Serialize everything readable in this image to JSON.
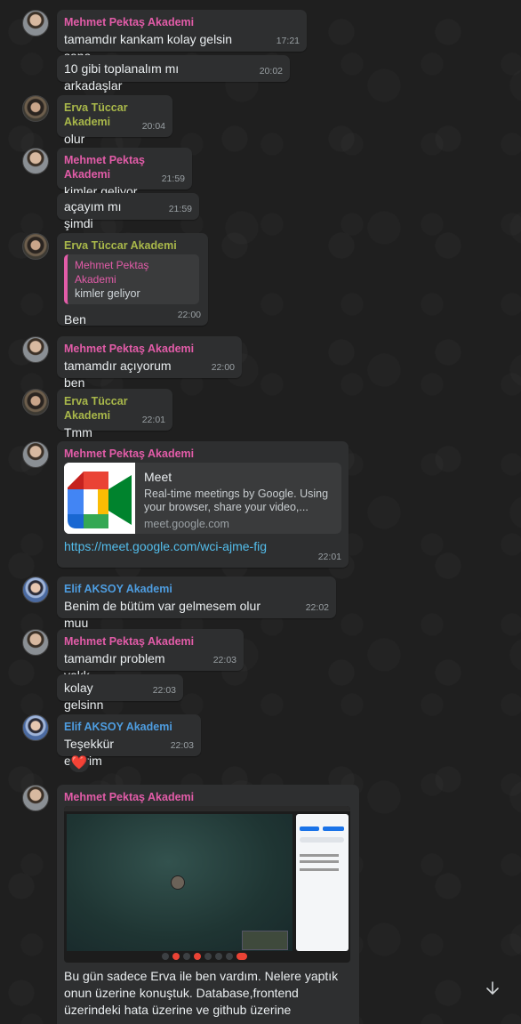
{
  "colors": {
    "background": "#1f1f1f",
    "bubble": "#2e2f30",
    "mehmet": "#e25ca8",
    "erva": "#a9b84a",
    "elif": "#4e9de0",
    "link": "#53bdeb"
  },
  "messages": {
    "m1": {
      "sender": "Mehmet Pektaş Akademi",
      "text": "tamamdır kankam kolay gelsin sana",
      "time": "17:21"
    },
    "m2": {
      "text": "10 gibi toplanalım mı arkadaşlar",
      "time": "20:02"
    },
    "m3": {
      "sender": "Erva Tüccar Akademi",
      "text": "olur",
      "time": "20:04"
    },
    "m4": {
      "sender": "Mehmet Pektaş Akademi",
      "text": "kimler geliyor",
      "time": "21:59"
    },
    "m5": {
      "text": "açayım mı şimdi",
      "time": "21:59"
    },
    "m6": {
      "sender": "Erva Tüccar Akademi",
      "quote_sender": "Mehmet Pektaş Akademi",
      "quote_text": "kimler geliyor",
      "text": "Ben",
      "time": "22:00"
    },
    "m7": {
      "sender": "Mehmet Pektaş Akademi",
      "text": "tamamdır açıyorum ben",
      "time": "22:00"
    },
    "m8": {
      "sender": "Erva Tüccar Akademi",
      "text": "Tmm",
      "time": "22:01"
    },
    "m9": {
      "sender": "Mehmet Pektaş Akademi",
      "link_title": "Meet",
      "link_desc": "Real-time meetings by Google. Using your browser, share your video,...",
      "link_domain": "meet.google.com",
      "url": "https://meet.google.com/wci-ajme-fig",
      "time": "22:01"
    },
    "m10": {
      "sender": "Elif AKSOY Akademi",
      "text": "Benim de bütüm var gelmesem olur muu",
      "time": "22:02"
    },
    "m11": {
      "sender": "Mehmet Pektaş Akademi",
      "text": "tamamdır problem yokk",
      "time": "22:03"
    },
    "m12": {
      "text": "kolay gelsinn",
      "time": "22:03"
    },
    "m13": {
      "sender": "Elif AKSOY Akademi",
      "text": "Teşekkür ederim",
      "time": "22:03",
      "reaction": "❤️"
    },
    "m14": {
      "sender": "Mehmet Pektaş Akademi",
      "text": "Bu gün sadece Erva ile ben vardım. Nelere yaptık onun üzerine konuştuk. Database,frontend üzerindeki hata üzerine ve github üzerine"
    }
  },
  "icons": {
    "scroll_down": "arrow-down-icon"
  }
}
